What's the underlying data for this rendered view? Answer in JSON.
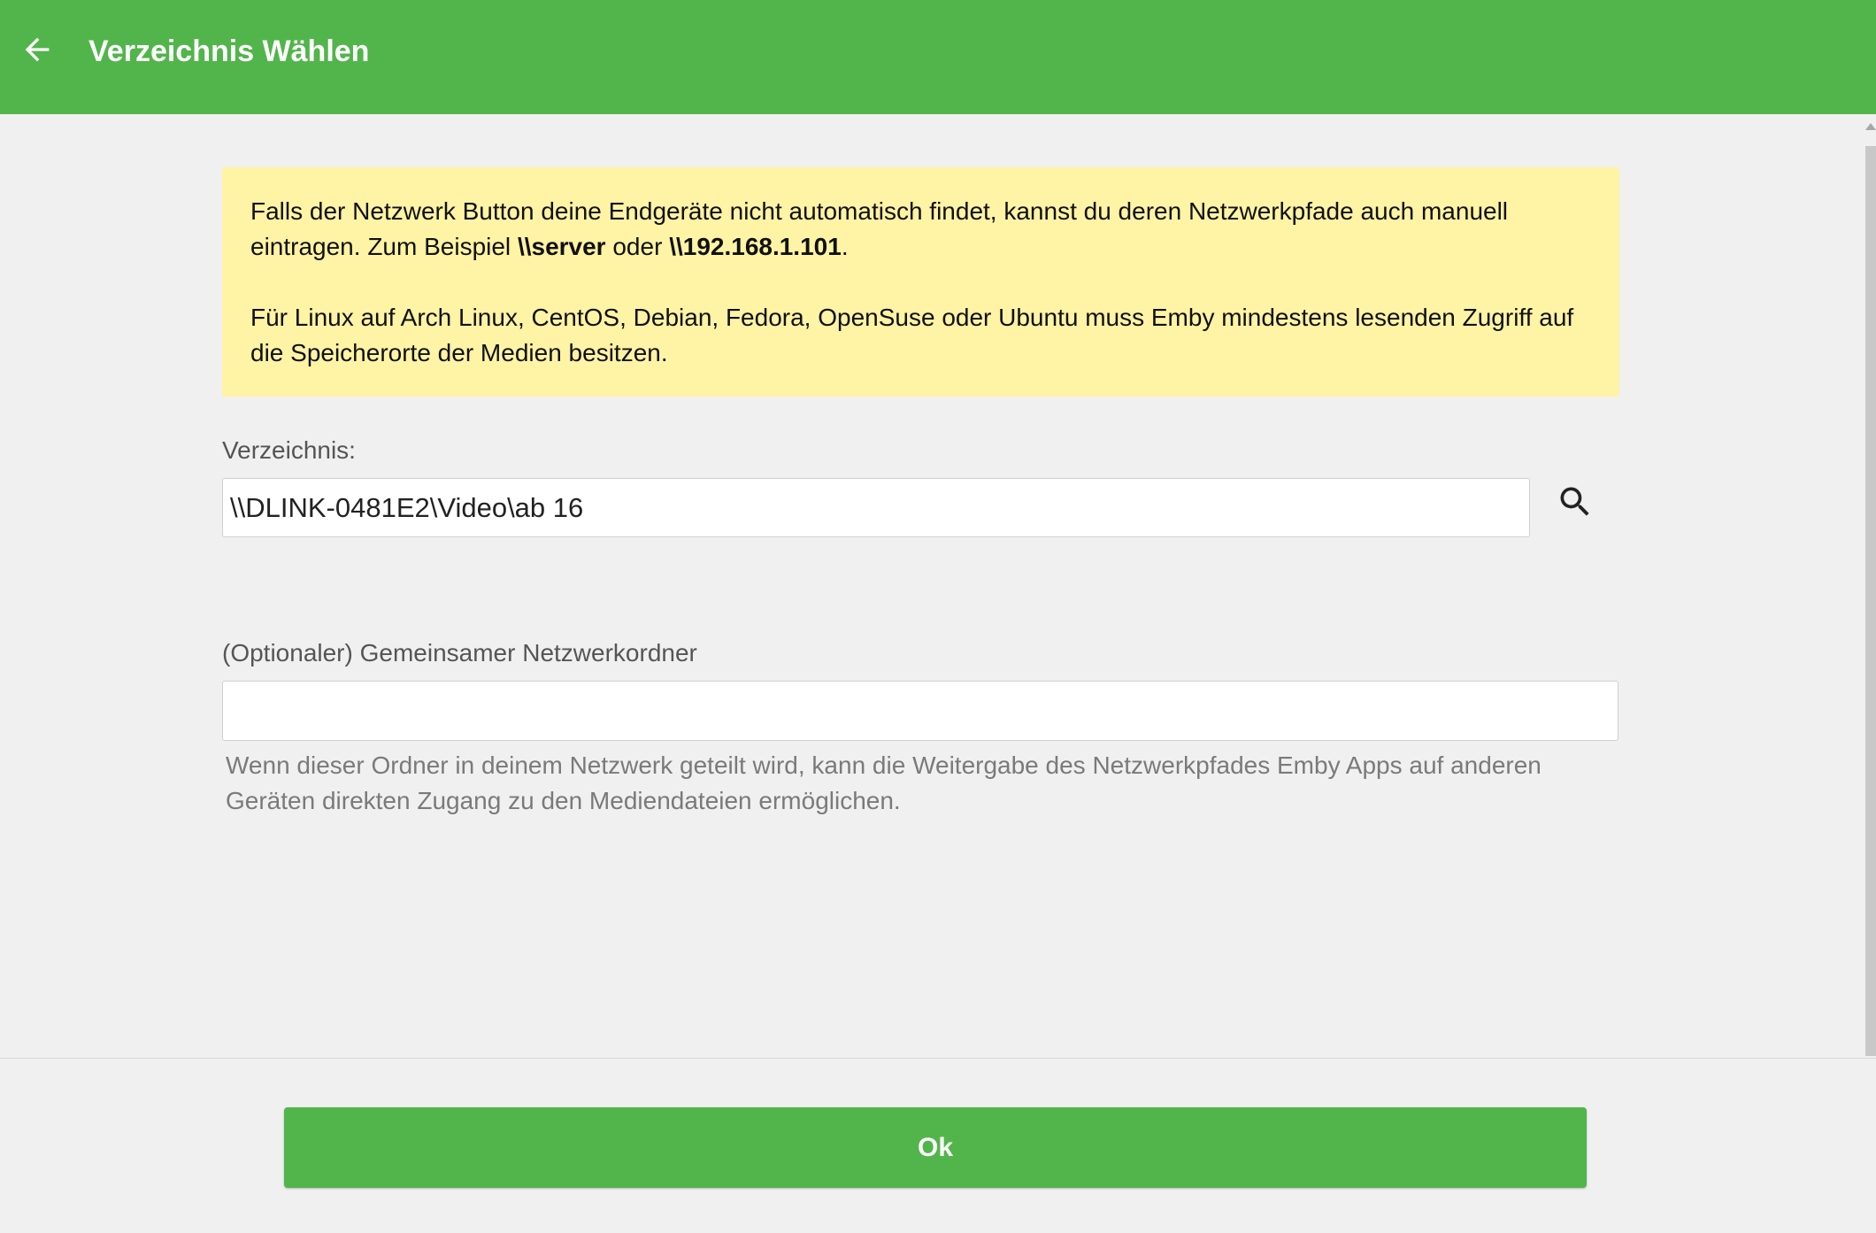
{
  "header": {
    "title": "Verzeichnis Wählen",
    "back_icon": "arrow-left-icon",
    "background": "#52b54b"
  },
  "info": {
    "para1": {
      "text1": "Falls der Netzwerk Button deine Endgeräte nicht automatisch findet, kannst du deren Netzwerkpfade auch manuell eintragen. Zum Beispiel ",
      "example1": "\\\\server",
      "text2": " oder ",
      "example2": "\\\\192.168.1.101",
      "text3": "."
    },
    "para2": "Für Linux auf Arch Linux, CentOS, Debian, Fedora, OpenSuse oder Ubuntu muss Emby mindestens lesenden Zugriff auf die Speicherorte der Medien besitzen.",
    "background": "#fff3a5"
  },
  "directory": {
    "label": "Verzeichnis:",
    "value": "\\\\DLINK-0481E2\\Video\\ab 16",
    "search_icon": "search-icon"
  },
  "network_share": {
    "label": "(Optionaler) Gemeinsamer Netzwerkordner",
    "value": "",
    "help": "Wenn dieser Ordner in deinem Netzwerk geteilt wird, kann die Weitergabe des Netzwerkpfades Emby Apps auf anderen Geräten direkten Zugang zu den Mediendateien ermöglichen."
  },
  "footer": {
    "ok_label": "Ok",
    "accent": "#52b54b"
  }
}
